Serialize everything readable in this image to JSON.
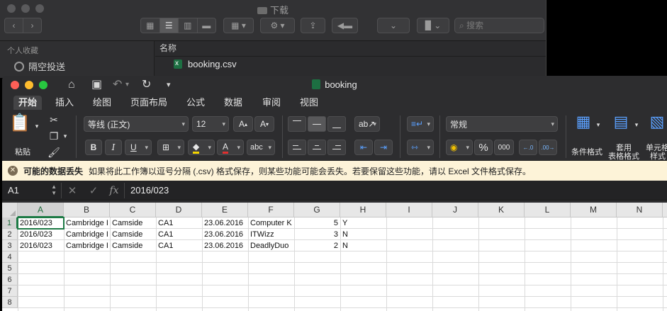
{
  "finder": {
    "title": "下载",
    "search_placeholder": "搜索",
    "sidebar_heading": "个人收藏",
    "sidebar_item": "隔空投送",
    "column_name": "名称",
    "file": "booking.csv"
  },
  "excel": {
    "doc_title": "booking",
    "tabs": [
      "开始",
      "插入",
      "绘图",
      "页面布局",
      "公式",
      "数据",
      "审阅",
      "视图"
    ],
    "ribbon": {
      "paste": "粘贴",
      "font_name": "等线 (正文)",
      "font_size": "12",
      "number_format": "常规",
      "conditional_format": "条件格式",
      "table_format_1": "套用",
      "table_format_2": "表格格式",
      "cell_style_1": "单元格",
      "cell_style_2": "样式",
      "bold": "B",
      "italic": "I",
      "underline": "U",
      "percent": "%",
      "thousands": "000",
      "grow_font": "A",
      "shrink_font": "A",
      "font_color": "A",
      "abc": "abc"
    },
    "warning": {
      "title": "可能的数据丢失",
      "message": "如果将此工作簿以逗号分隔 (.csv) 格式保存，则某些功能可能会丢失。若要保留这些功能，请以 Excel 文件格式保存。"
    },
    "formula_bar": {
      "name_box": "A1",
      "fx": "fx",
      "value": "2016/023"
    },
    "sheet": {
      "columns": [
        "A",
        "B",
        "C",
        "D",
        "E",
        "F",
        "G",
        "H",
        "I",
        "J",
        "K",
        "L",
        "M",
        "N"
      ],
      "row_numbers": [
        "1",
        "2",
        "3",
        "4",
        "5",
        "6",
        "7",
        "8"
      ],
      "rows": [
        [
          "2016/023",
          "Cambridge I",
          "Camside",
          "CA1",
          "23.06.2016",
          "Computer K",
          "5",
          "Y"
        ],
        [
          "2016/023",
          "Cambridge I",
          "Camside",
          "CA1",
          "23.06.2016",
          "ITWizz",
          "3",
          "N"
        ],
        [
          "2016/023",
          "Cambridge I",
          "Camside",
          "CA1",
          "23.06.2016",
          "DeadlyDuo",
          "2",
          "N"
        ]
      ]
    }
  }
}
